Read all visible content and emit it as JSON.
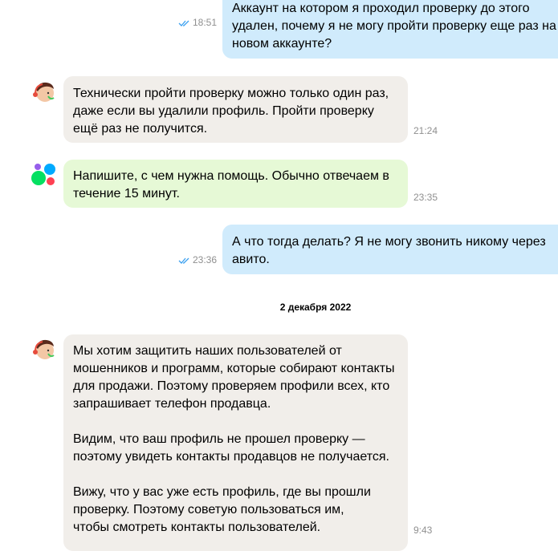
{
  "messages": [
    {
      "type": "outgoing",
      "lines": [
        "Аккаунт на котором я проходил проверку до этого",
        "удален, почему я не могу пройти проверку еще раз на",
        "новом аккаунте?"
      ],
      "time": "18:51",
      "read": true
    },
    {
      "type": "incoming-agent",
      "lines": [
        "Технически пройти проверку можно только один раз,",
        "даже если вы удалили профиль. Пройти проверку",
        "ещё раз не получится."
      ],
      "time": "21:24"
    },
    {
      "type": "incoming-bot",
      "lines": [
        "Напишите, с чем нужна помощь. Обычно отвечаем в",
        "течение 15 минут."
      ],
      "time": "23:35"
    },
    {
      "type": "outgoing",
      "lines": [
        "А что тогда делать? Я не могу звонить никому через",
        "авито."
      ],
      "time": "23:36",
      "read": true
    },
    {
      "type": "incoming-agent",
      "lines": [
        "Мы хотим защитить наших пользователей от",
        "мошенников и программ, которые собирают контакты",
        "для продажи. Поэтому проверяем профили всех, кто",
        "запрашивает телефон продавца.",
        "",
        "Видим, что ваш профиль не прошел проверку —",
        "поэтому увидеть контакты продавцов не получается.",
        "",
        "Вижу, что у вас уже есть профиль, где вы прошли",
        "проверку. Поэтому советую пользоваться им,",
        "чтобы смотреть контакты пользователей."
      ],
      "time": "9:43"
    }
  ],
  "date_separator": "2 декабря 2022",
  "colors": {
    "outgoing_bg": "#d0ebfc",
    "incoming_bg": "#f1eeea",
    "bot_bg": "#e6f9d6",
    "tick_color": "#3aa0f0",
    "time_color": "#8f8f8f"
  },
  "icons": {
    "agent_avatar": "support-agent-avatar-icon",
    "bot_avatar": "avito-logo-icon",
    "read_ticks": "double-check-icon"
  }
}
